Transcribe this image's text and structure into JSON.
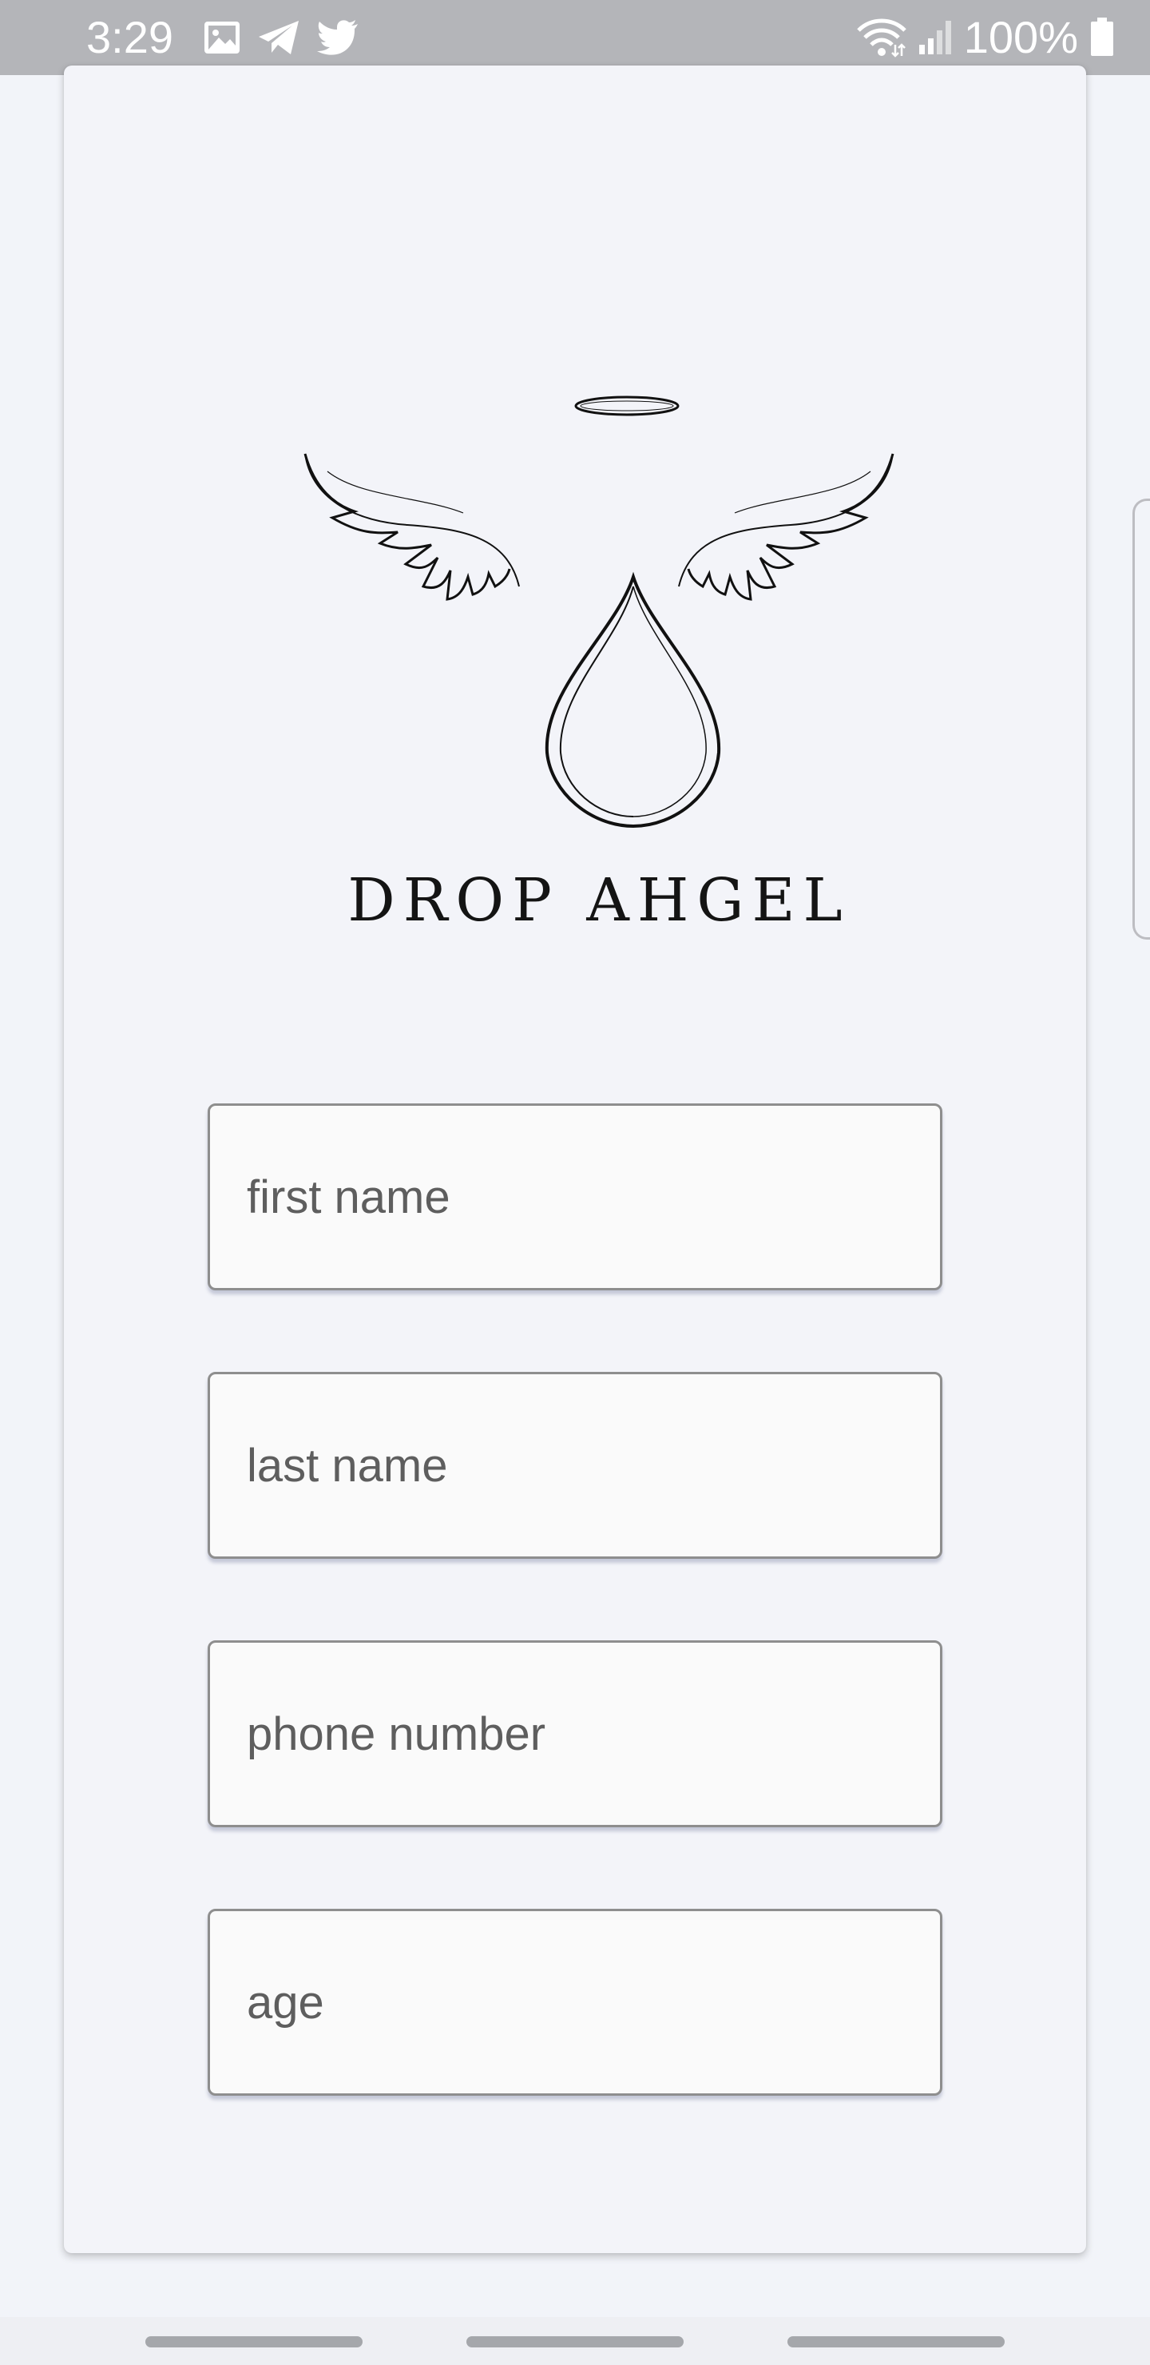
{
  "status_bar": {
    "time": "3:29",
    "battery_text": "100%",
    "left_icons": [
      "gallery-icon",
      "telegram-icon",
      "twitter-icon"
    ],
    "right_icons": [
      "wifi-icon",
      "signal-icon",
      "battery-icon"
    ]
  },
  "logo": {
    "brand_name": "DROP AHGEL",
    "icon": "angel-drop-logo"
  },
  "form": {
    "first_name_placeholder": "first name",
    "last_name_placeholder": "last name",
    "phone_placeholder": "phone number",
    "age_placeholder": "age",
    "first_name_value": "",
    "last_name_value": "",
    "phone_value": "",
    "age_value": ""
  },
  "colors": {
    "background": "#f2f4f9",
    "status_bar": "#b4b5b9",
    "field_border": "#8e8e8e"
  },
  "nav_bar": {
    "items": [
      "recents-pill",
      "home-pill",
      "back-pill"
    ]
  }
}
